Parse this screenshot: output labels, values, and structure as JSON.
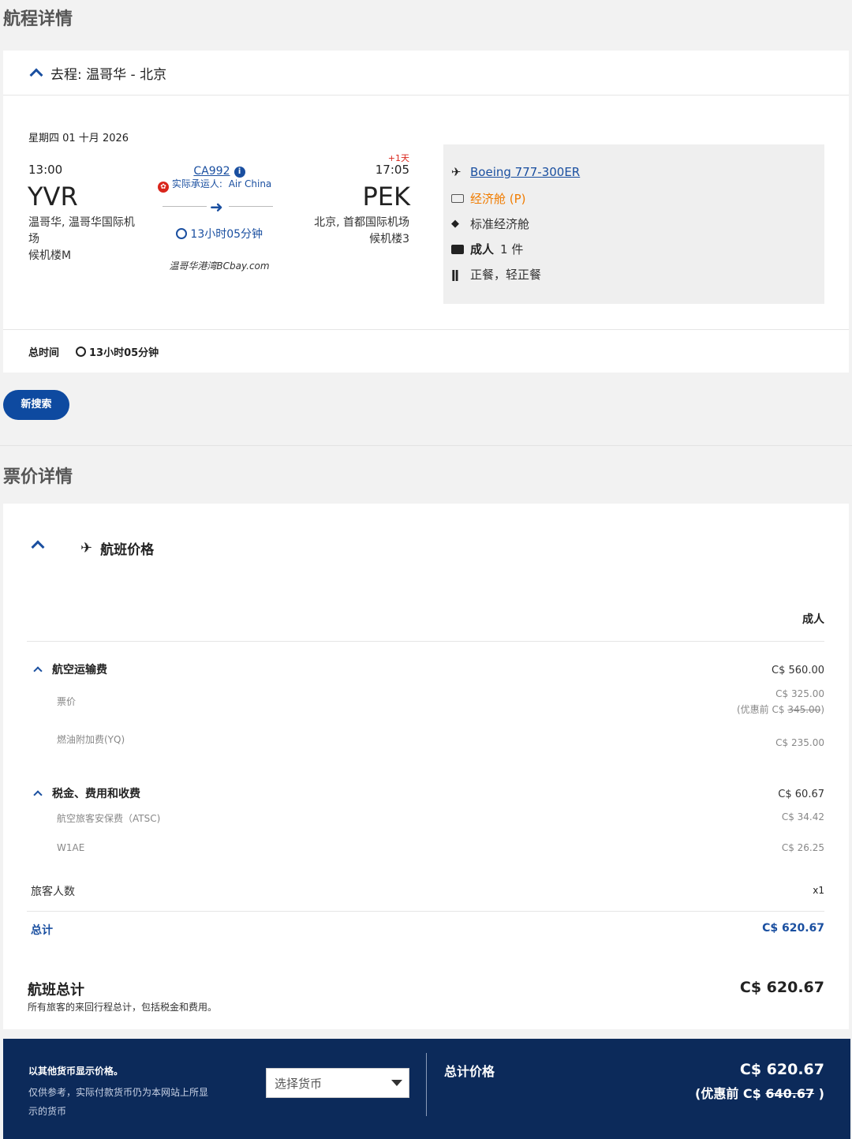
{
  "itinerary": {
    "section_title": "航程详情",
    "leg_header": "去程: 温哥华 - 北京",
    "date": "星期四 01 十月 2026",
    "depart_time": "13:00",
    "depart_code": "YVR",
    "depart_city_line1": "温哥华, 温哥华国际机",
    "depart_city_line2": "场",
    "depart_terminal": "候机楼M",
    "flight_number": "CA992",
    "carrier_label": "实际承运人:",
    "carrier_name": "Air China",
    "duration": "13小时05分钟",
    "watermark": "温哥华港湾BCbay.com",
    "day_offset": "+1天",
    "arrive_time": "17:05",
    "arrive_code": "PEK",
    "arrive_city": "北京, 首都国际机场",
    "arrive_terminal": "候机楼3",
    "details": {
      "aircraft": "Boeing 777-300ER",
      "cabin": "经济舱 (P)",
      "fare_family": "标准经济舱",
      "baggage_label": "成人",
      "baggage_count": "1 件",
      "meal": "正餐，轻正餐"
    },
    "total_time_label": "总时间",
    "total_time": "13小时05分钟"
  },
  "new_search_label": "新搜索",
  "fare": {
    "section_title": "票价详情",
    "flight_price_label": "航班价格",
    "passenger_type": "成人",
    "air_transport": {
      "label": "航空运输费",
      "amount": "C$ 560.00"
    },
    "base_fare": {
      "label": "票价",
      "amount": "C$ 325.00",
      "before_prefix": "(优惠前 C$ ",
      "before_amount": "345.00",
      "before_suffix": ")"
    },
    "fuel": {
      "label": "燃油附加费(YQ)",
      "amount": "C$ 235.00"
    },
    "taxes": {
      "label": "税金、费用和收费",
      "amount": "C$ 60.67"
    },
    "atsc": {
      "label": "航空旅客安保费（ATSC)",
      "amount": "C$ 34.42"
    },
    "w1ae": {
      "label": "W1AE",
      "amount": "C$ 26.25"
    },
    "pax_count_label": "旅客人数",
    "pax_count": "x1",
    "subtotal_label": "总计",
    "subtotal": "C$ 620.67",
    "flight_total_label": "航班总计",
    "flight_total_note": "所有旅客的来回行程总计，包括税金和费用。",
    "flight_total": "C$ 620.67"
  },
  "currency_panel": {
    "title": "以其他货币显示价格。",
    "note_line1": "仅供参考，实际付款货币仍为本网站上所显",
    "note_line2": "示的货币",
    "select_placeholder": "选择货币",
    "total_label": "总计价格",
    "total": "C$ 620.67",
    "before_prefix": "(优惠前 C$ ",
    "before_amount": "640.67",
    "before_suffix": " )"
  },
  "colors": {
    "brand_blue": "#1a4fa0",
    "cabin_orange": "#f07c00",
    "panel_navy": "#0c2a5a"
  }
}
